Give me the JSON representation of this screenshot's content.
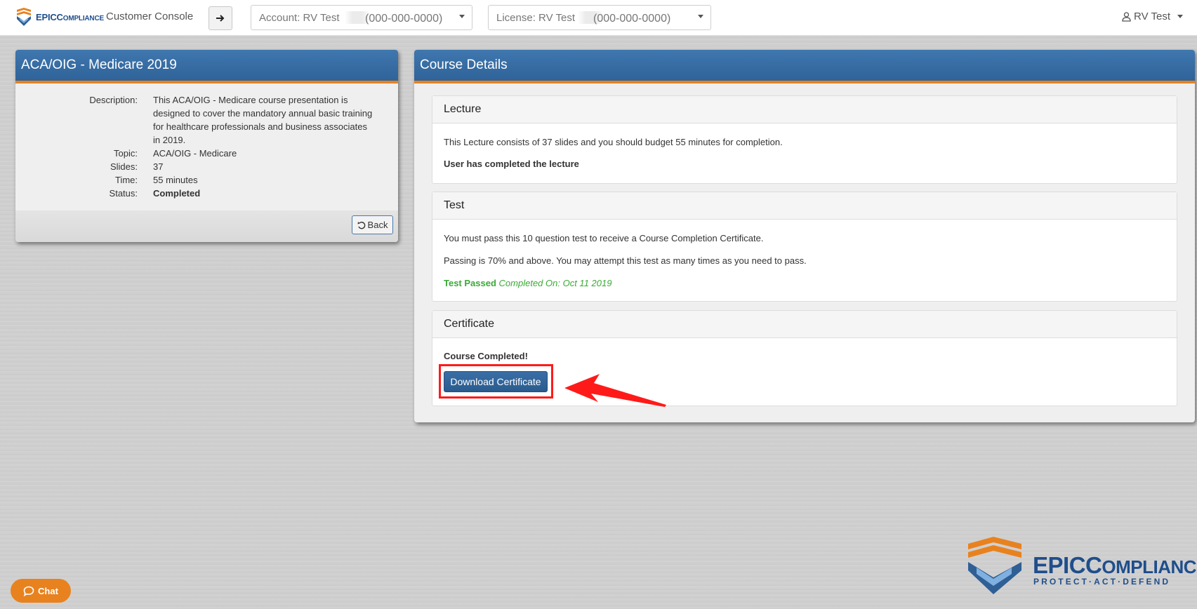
{
  "header": {
    "logo_text_big": "EPIC",
    "logo_text_small": "OMPLIANCE",
    "logo_text_c": "C",
    "console_title": "Customer Console",
    "go_icon": "arrow-right-icon",
    "account_label": "Account: RV Test",
    "account_number": "(000-000-0000)",
    "license_label": "License: RV Test",
    "license_number": "(000-000-0000)",
    "user_name": "RV Test"
  },
  "course": {
    "title": "ACA/OIG - Medicare 2019",
    "description_label": "Description:",
    "description": "This ACA/OIG - Medicare course presentation is designed to cover the mandatory annual basic training for healthcare professionals and business associates in 2019.",
    "topic_label": "Topic:",
    "topic": "ACA/OIG - Medicare",
    "slides_label": "Slides:",
    "slides": "37",
    "time_label": "Time:",
    "time": "55 minutes",
    "status_label": "Status:",
    "status": "Completed",
    "back_label": "Back"
  },
  "details": {
    "title": "Course Details",
    "lecture": {
      "heading": "Lecture",
      "text": "This Lecture consists of 37 slides and you should budget 55 minutes for completion.",
      "status": "User has completed the lecture"
    },
    "test": {
      "heading": "Test",
      "text1": "You must pass this 10 question test to receive a Course Completion Certificate.",
      "text2": "Passing is 70% and above. You may attempt this test as many times as you need to pass.",
      "status": "Test Passed",
      "completed_on": "Completed On: Oct 11 2019"
    },
    "certificate": {
      "heading": "Certificate",
      "status": "Course Completed!",
      "button": "Download Certificate"
    }
  },
  "chat": {
    "label": "Chat"
  },
  "brand": {
    "name_big": "EPIC",
    "name_c": "C",
    "name_small": "OMPLIANCE",
    "tagline": "PROTECT·ACT·DEFEND"
  },
  "colors": {
    "header_blue": "#2f6399",
    "accent_orange": "#e8821f",
    "success_green": "#3aaa35",
    "annotation_red": "#ff1a1a"
  }
}
